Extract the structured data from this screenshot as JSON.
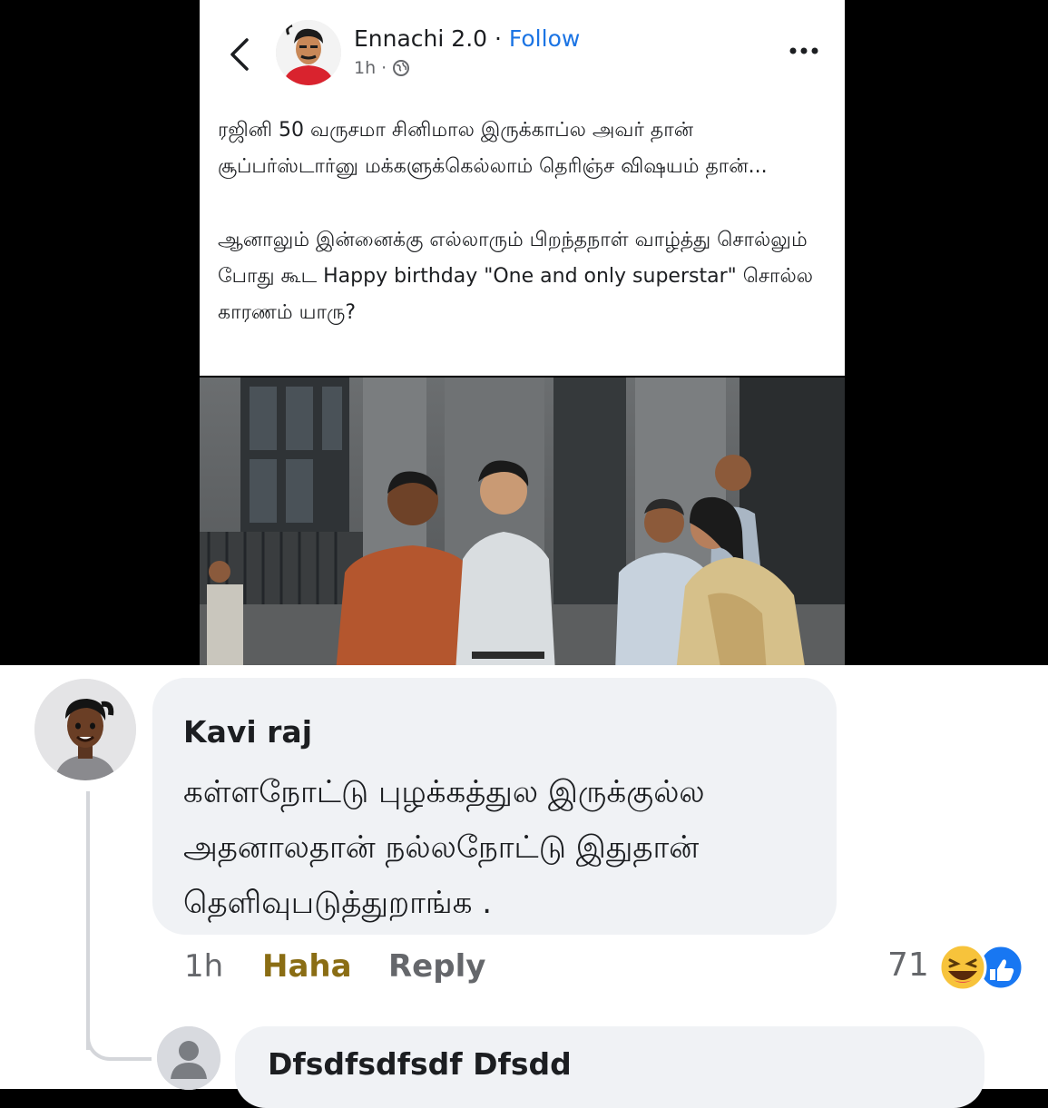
{
  "post": {
    "author_name": "Ennachi 2.0",
    "separator": " · ",
    "follow_label": "Follow",
    "time": "1h",
    "meta_dot": "·",
    "text_paragraph_1": "ரஜினி 50 வருசமா சினிமால இருக்காப்ல அவர் தான் சூப்பர்ஸ்டார்னு மக்களுக்கெல்லாம் தெரிஞ்ச விஷயம் தான்...",
    "text_paragraph_2": "ஆனாலும் இன்னைக்கு எல்லாரும் பிறந்தநாள் வாழ்த்து சொல்லும் போது கூட Happy birthday \"One and only superstar\" சொல்ல காரணம் யாரு?"
  },
  "comment": {
    "author_name": "Kavi raj",
    "text": "கள்ளநோட்டு புழக்கத்துல இருக்குல்ல அதனாலதான் நல்லநோட்டு இதுதான் தெளிவுபடுத்துறாங்க .",
    "time": "1h",
    "haha_label": "Haha",
    "reply_label": "Reply",
    "reaction_count": "71",
    "reactions": [
      "haha-icon",
      "like-icon"
    ]
  },
  "reply": {
    "author_name": "Dfsdfsdfsdf Dfsdd"
  },
  "colors": {
    "follow": "#1b74e4",
    "haha_active": "#8a6d14",
    "bubble": "#f0f2f5",
    "like_blue": "#1877f2",
    "haha_yellow": "#f7c33b"
  }
}
